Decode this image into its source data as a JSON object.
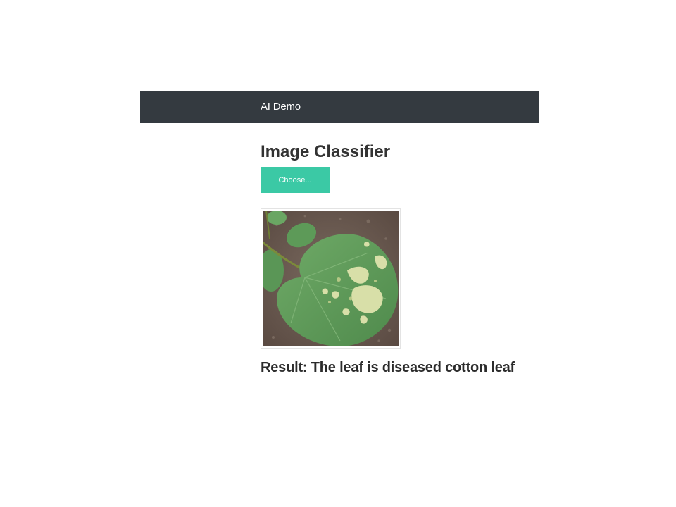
{
  "navbar": {
    "brand": "AI Demo"
  },
  "main": {
    "title": "Image Classifier",
    "upload_button_label": "Choose...",
    "result_label": "Result:",
    "result_text": "The leaf is diseased cotton leaf"
  },
  "colors": {
    "navbar_bg": "#343a40",
    "button_bg": "#3bc9a5",
    "leaf_green": "#5f9e5a",
    "disease_spot": "#d8dfa8",
    "soil": "#6b5a50"
  },
  "preview_image": {
    "subject": "cotton-leaf-photo"
  }
}
